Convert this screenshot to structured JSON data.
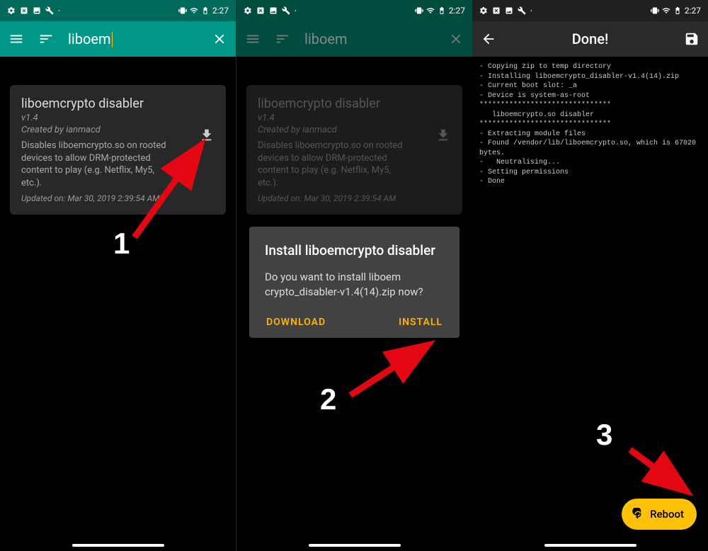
{
  "status": {
    "time": "2:27"
  },
  "panel1": {
    "search": "liboem",
    "card": {
      "title": "liboemcrypto disabler",
      "version": "v1.4",
      "author": "Created by ianmacd",
      "desc": "Disables liboemcrypto.so on rooted devices to allow DRM-protected content to play (e.g. Netflix, My5, etc.).",
      "updated": "Updated on: Mar 30, 2019 2:39:54 AM"
    }
  },
  "panel2": {
    "search": "liboem",
    "dialog": {
      "title": "Install liboemcrypto disabler",
      "msg": "Do you want to install liboem crypto_disabler-v1.4(14).zip now?",
      "download": "DOWNLOAD",
      "install": "INSTALL"
    }
  },
  "panel3": {
    "done": "Done!",
    "log": "- Copying zip to temp directory\n- Installing liboemcrypto_disabler-v1.4(14).zip\n- Current boot slot: _a\n- Device is system-as-root\n*******************************\n   liboemcrypto.so disabler\n*******************************\n- Extracting module files\n- Found /vendor/lib/liboemcrypto.so, which is 67020 bytes.\n-   Neutralising...\n- Setting permissions\n- Done",
    "fab": "Reboot"
  },
  "steps": {
    "s1": "1",
    "s2": "2",
    "s3": "3"
  }
}
